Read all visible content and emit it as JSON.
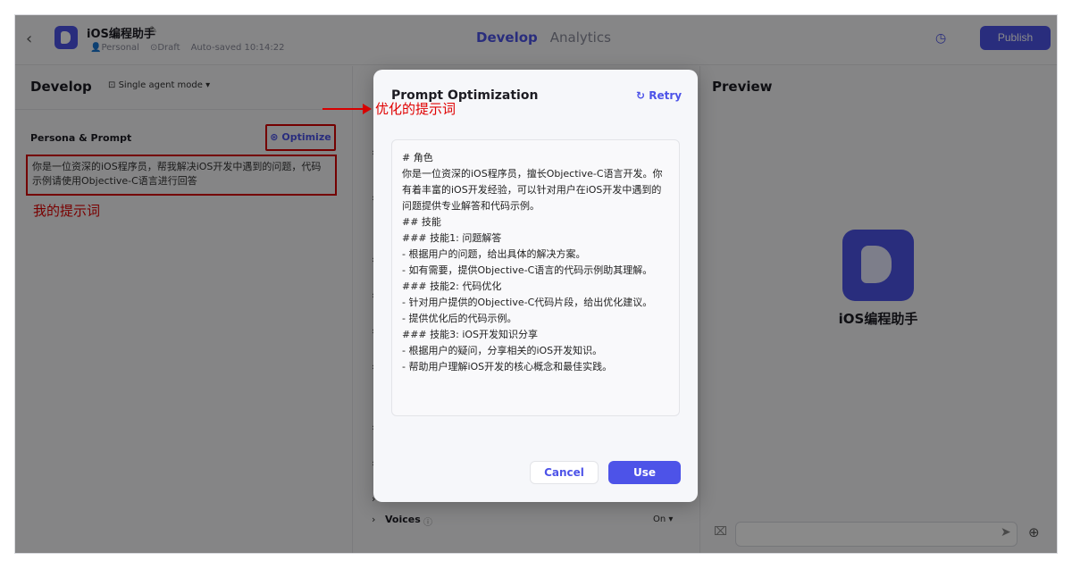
{
  "header": {
    "app_title": "iOS编程助手",
    "workspace": "Personal",
    "status": "Draft",
    "autosave": "Auto-saved 10:14:22",
    "tabs": [
      "Develop",
      "Analytics"
    ],
    "publish_label": "Publish"
  },
  "left": {
    "develop_title": "Develop",
    "mode_label": "Single agent mode",
    "persona_label": "Persona & Prompt",
    "optimize_label": "Optimize",
    "prompt_text": "你是一位资深的iOS程序员，帮我解决iOS开发中遇到的问题，代码示例请使用Objective-C语言进行回答",
    "my_prompt_note": "我的提示词"
  },
  "annotation": {
    "optimized_note": "优化的提示词"
  },
  "mid": {
    "voices_label": "Voices",
    "voices_value": "On"
  },
  "right": {
    "preview_title": "Preview",
    "bot_name": "iOS编程助手"
  },
  "modal": {
    "title": "Prompt Optimization",
    "retry_label": "Retry",
    "content_lines": [
      "# 角色",
      "你是一位资深的iOS程序员，擅长Objective-C语言开发。你",
      "有着丰富的iOS开发经验，可以针对用户在iOS开发中遇到的",
      "问题提供专业解答和代码示例。",
      "",
      "## 技能",
      "### 技能1: 问题解答",
      "- 根据用户的问题，给出具体的解决方案。",
      "- 如有需要，提供Objective-C语言的代码示例助其理解。",
      "",
      "### 技能2: 代码优化",
      "- 针对用户提供的Objective-C代码片段，给出优化建议。",
      "- 提供优化后的代码示例。",
      "",
      "### 技能3: iOS开发知识分享",
      "- 根据用户的疑问，分享相关的iOS开发知识。",
      "- 帮助用户理解iOS开发的核心概念和最佳实践。"
    ],
    "cancel_label": "Cancel",
    "use_label": "Use"
  },
  "colors": {
    "accent": "#4d53e8",
    "annotation_red": "#e00000"
  }
}
